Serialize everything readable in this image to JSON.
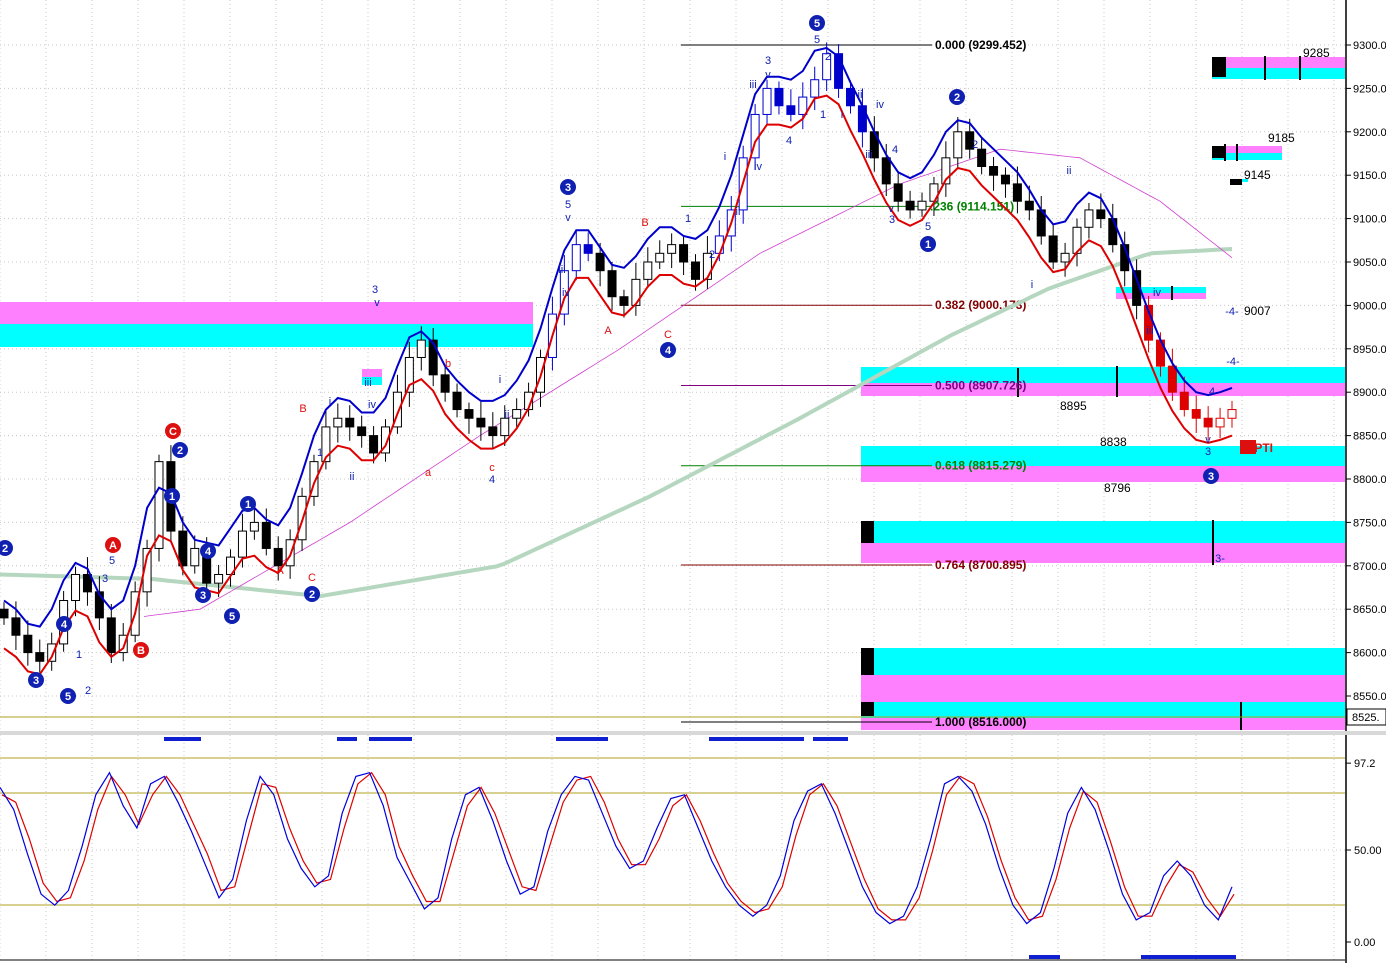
{
  "chart_data": [
    {
      "type": "candlestick",
      "y_axis_ticks": [
        "9300.00",
        "9250.00",
        "9200.00",
        "9150.00",
        "9100.00",
        "9050.00",
        "9000.00",
        "8950.00",
        "8900.00",
        "8850.00",
        "8800.00",
        "8750.00",
        "8700.00",
        "8650.00",
        "8600.00",
        "8550.00"
      ],
      "y_ticks_values": [
        9300,
        9250,
        9200,
        9150,
        9100,
        9050,
        9000,
        8950,
        8900,
        8850,
        8800,
        8750,
        8700,
        8650,
        8600,
        8550
      ],
      "ylim": [
        8507,
        9320
      ],
      "last_price": {
        "value": 8525,
        "label": "8525."
      },
      "fib_levels": [
        {
          "value": 9299.452,
          "label": "0.000 (9299.452)"
        },
        {
          "value": 9114.151,
          "label": ".236 (9114.151)"
        },
        {
          "value": 9000.173,
          "label": "0.382 (9000.173)"
        },
        {
          "value": 8907.726,
          "label": "0.500 (8907.726)"
        },
        {
          "value": 8815.279,
          "label": "0.618 (8815.279)"
        },
        {
          "value": 8700.895,
          "label": "0.764 (8700.895)"
        },
        {
          "value": 8516.0,
          "label": "1.000 (8516.000)"
        }
      ],
      "price_annotations": [
        {
          "label": "9285",
          "value": 9285
        },
        {
          "label": "9185",
          "value": 9185
        },
        {
          "label": "9145",
          "value": 9145
        },
        {
          "label": "9007",
          "value": 9007
        },
        {
          "label": "8895",
          "value": 8895
        },
        {
          "label": "8838",
          "value": 8838
        },
        {
          "label": "8796",
          "value": 8796
        }
      ],
      "indicator_tag": "65PTI",
      "wave_labels": [
        "5",
        "2",
        "1",
        "3",
        "4",
        "A",
        "B",
        "C",
        "i",
        "ii",
        "iii",
        "iv",
        "v",
        "a",
        "b",
        "c"
      ],
      "close": [
        8640,
        8620,
        8600,
        8590,
        8610,
        8660,
        8690,
        8670,
        8640,
        8600,
        8620,
        8670,
        8720,
        8820,
        8740,
        8700,
        8720,
        8680,
        8690,
        8710,
        8740,
        8750,
        8720,
        8700,
        8730,
        8780,
        8820,
        8860,
        8870,
        8860,
        8850,
        8830,
        8860,
        8900,
        8940,
        8960,
        8920,
        8900,
        8880,
        8870,
        8860,
        8850,
        8870,
        8880,
        8900,
        8940,
        8990,
        9040,
        9070,
        9060,
        9040,
        9010,
        9000,
        9030,
        9050,
        9060,
        9070,
        9050,
        9030,
        9060,
        9080,
        9110,
        9170,
        9220,
        9250,
        9230,
        9220,
        9240,
        9260,
        9290,
        9250,
        9230,
        9200,
        9170,
        9140,
        9120,
        9110,
        9120,
        9140,
        9170,
        9200,
        9180,
        9160,
        9150,
        9140,
        9120,
        9110,
        9080,
        9050,
        9060,
        9090,
        9110,
        9100,
        9070,
        9040,
        9000,
        8960,
        8930,
        8900,
        8880,
        8870,
        8860,
        8870,
        8880
      ]
    },
    {
      "type": "line",
      "name": "stochastic",
      "y_axis_ticks": [
        "97.2",
        "50.00",
        "0.00"
      ],
      "ylim": [
        0,
        100
      ],
      "series": [
        {
          "values": [
            84,
            72,
            48,
            26,
            20,
            28,
            52,
            80,
            92,
            74,
            62,
            86,
            90,
            76,
            60,
            42,
            24,
            34,
            66,
            90,
            80,
            56,
            40,
            30,
            36,
            70,
            90,
            92,
            74,
            46,
            32,
            18,
            24,
            56,
            80,
            84,
            66,
            44,
            26,
            30,
            60,
            80,
            90,
            88,
            70,
            52,
            40,
            44,
            62,
            78,
            80,
            62,
            44,
            30,
            20,
            14,
            20,
            36,
            66,
            82,
            86,
            70,
            50,
            30,
            16,
            10,
            14,
            30,
            56,
            86,
            90,
            82,
            64,
            40,
            20,
            10,
            16,
            40,
            70,
            84,
            72,
            50,
            26,
            12,
            16,
            36,
            44,
            36,
            20,
            12,
            30
          ]
        },
        {
          "values": [
            80,
            76,
            56,
            32,
            22,
            24,
            44,
            72,
            90,
            80,
            64,
            80,
            90,
            80,
            64,
            48,
            28,
            30,
            58,
            86,
            84,
            62,
            44,
            32,
            34,
            62,
            86,
            92,
            80,
            52,
            36,
            22,
            22,
            48,
            74,
            84,
            70,
            50,
            30,
            28,
            52,
            76,
            88,
            90,
            76,
            56,
            42,
            42,
            56,
            74,
            80,
            66,
            48,
            32,
            22,
            16,
            18,
            30,
            58,
            80,
            86,
            74,
            54,
            34,
            18,
            12,
            12,
            24,
            50,
            80,
            90,
            86,
            68,
            44,
            24,
            12,
            14,
            34,
            62,
            82,
            76,
            54,
            30,
            14,
            14,
            30,
            42,
            38,
            24,
            14,
            26
          ]
        }
      ]
    }
  ]
}
